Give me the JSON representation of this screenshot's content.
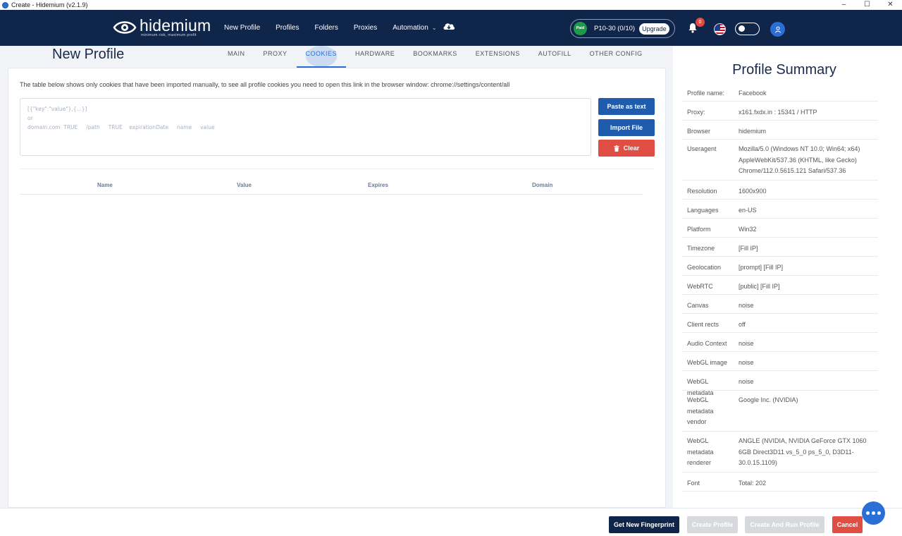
{
  "window": {
    "title": "Create - Hidemium (v2.1.9)"
  },
  "brand": {
    "name": "hidemium",
    "tagline": "minimum risk, maximum profit"
  },
  "nav": {
    "links": [
      "New Profile",
      "Profiles",
      "Folders",
      "Proxies",
      "Automation"
    ]
  },
  "plan": {
    "badge": "Paid",
    "label": "P10-30 (0/10)",
    "upgrade": "Upgrade"
  },
  "notifications": {
    "count": "0"
  },
  "page": {
    "title": "New Profile"
  },
  "tabs": [
    "MAIN",
    "PROXY",
    "COOKIES",
    "HARDWARE",
    "BOOKMARKS",
    "EXTENSIONS",
    "AUTOFILL",
    "OTHER CONFIG"
  ],
  "cookies": {
    "notice": "The table below shows only cookies that have been imported manually, to see all profile cookies you need to open this link in the browser window: chrome://settings/content/all",
    "placeholder_lines": [
      "[{\"key\":\"value\"},{...}]",
      "or",
      "domain.com  TRUE     /path     TRUE    expirationDate     name     value"
    ],
    "buttons": {
      "paste": "Paste as text",
      "import": "Import File",
      "clear": "Clear"
    },
    "columns": [
      "Name",
      "Value",
      "Expires",
      "Domain"
    ]
  },
  "summary": {
    "title": "Profile Summary",
    "rows": [
      {
        "k": "Profile name:",
        "v": "Facebook"
      },
      {
        "k": "Proxy:",
        "v": "x161.fxdx.in : 15341 / HTTP"
      },
      {
        "k": "Browser",
        "v": "hidemium"
      },
      {
        "k": "Useragent",
        "v": "Mozilla/5.0 (Windows NT 10.0; Win64; x64) AppleWebKit/537.36 (KHTML, like Gecko) Chrome/112.0.5615.121 Safari/537.36"
      },
      {
        "k": "Resolution",
        "v": "1600x900"
      },
      {
        "k": "Languages",
        "v": "en-US"
      },
      {
        "k": "Platform",
        "v": "Win32"
      },
      {
        "k": "Timezone",
        "v": "[Fill IP]"
      },
      {
        "k": "Geolocation",
        "v": "[prompt] [Fill IP]"
      },
      {
        "k": "WebRTC",
        "v": "[public] [Fill IP]"
      },
      {
        "k": "Canvas",
        "v": "noise"
      },
      {
        "k": "Client rects",
        "v": "off"
      },
      {
        "k": "Audio Context",
        "v": "noise"
      },
      {
        "k": "WebGL image",
        "v": "noise"
      },
      {
        "k": "WebGL metadata",
        "v": "noise"
      },
      {
        "k": "WebGL metadata vendor",
        "v": "Google Inc. (NVIDIA)"
      },
      {
        "k": "WebGL metadata renderer",
        "v": "ANGLE (NVIDIA, NVIDIA GeForce GTX 1060 6GB Direct3D11 vs_5_0 ps_5_0, D3D11-30.0.15.1109)"
      },
      {
        "k": "Font",
        "v": "Total: 202"
      }
    ]
  },
  "footer": {
    "fingerprint": "Get New Fingerprint",
    "create": "Create Profile",
    "create_run": "Create And Run Profile",
    "cancel": "Cancel"
  },
  "colors": {
    "nav_bg": "#10254a",
    "accent": "#2a6fd6",
    "danger": "#e04e43",
    "primary_btn": "#1f5cad"
  }
}
